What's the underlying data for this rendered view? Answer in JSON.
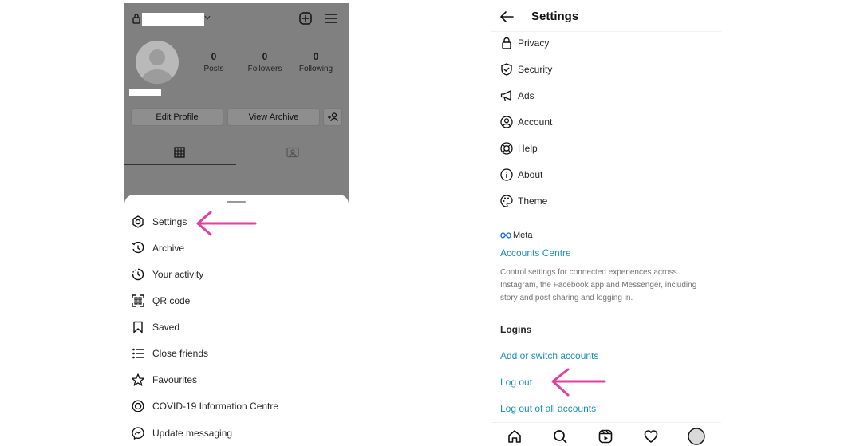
{
  "left": {
    "profile": {
      "stats": [
        {
          "value": "0",
          "label": "Posts"
        },
        {
          "value": "0",
          "label": "Followers"
        },
        {
          "value": "0",
          "label": "Following"
        }
      ],
      "edit_profile": "Edit Profile",
      "view_archive": "View Archive"
    },
    "menu": [
      {
        "label": "Settings",
        "icon": "settings-icon"
      },
      {
        "label": "Archive",
        "icon": "archive-icon"
      },
      {
        "label": "Your activity",
        "icon": "activity-icon"
      },
      {
        "label": "QR code",
        "icon": "qr-code-icon"
      },
      {
        "label": "Saved",
        "icon": "bookmark-icon"
      },
      {
        "label": "Close friends",
        "icon": "close-friends-icon"
      },
      {
        "label": "Favourites",
        "icon": "star-icon"
      },
      {
        "label": "COVID-19 Information Centre",
        "icon": "covid-info-icon"
      },
      {
        "label": "Update messaging",
        "icon": "messenger-icon"
      }
    ]
  },
  "right": {
    "title": "Settings",
    "items": [
      {
        "label": "Privacy",
        "icon": "lock-icon"
      },
      {
        "label": "Security",
        "icon": "shield-icon"
      },
      {
        "label": "Ads",
        "icon": "megaphone-icon"
      },
      {
        "label": "Account",
        "icon": "account-icon"
      },
      {
        "label": "Help",
        "icon": "lifebuoy-icon"
      },
      {
        "label": "About",
        "icon": "info-icon"
      },
      {
        "label": "Theme",
        "icon": "palette-icon"
      }
    ],
    "meta": {
      "logo_text": "Meta",
      "accounts_centre": "Accounts Centre",
      "description": "Control settings for connected experiences across Instagram, the Facebook app and Messenger, including story and post sharing and logging in."
    },
    "logins": {
      "title": "Logins",
      "add_switch": "Add or switch accounts",
      "log_out": "Log out",
      "log_out_all": "Log out of all accounts"
    },
    "nav": [
      "home-icon",
      "search-icon",
      "reels-icon",
      "heart-icon",
      "profile-avatar-icon"
    ]
  },
  "colors": {
    "link": "#1b8fb8",
    "arrow": "#e040a0",
    "overlay": "#808080"
  }
}
